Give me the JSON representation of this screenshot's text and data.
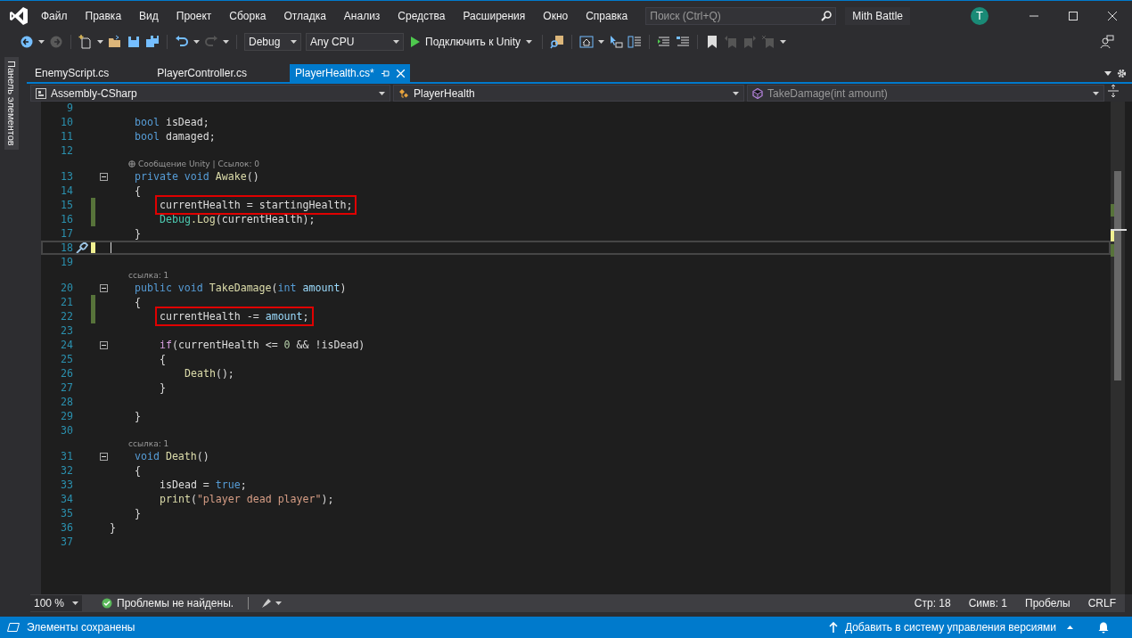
{
  "menu": [
    "Файл",
    "Правка",
    "Вид",
    "Проект",
    "Сборка",
    "Отладка",
    "Анализ",
    "Средства",
    "Расширения",
    "Окно",
    "Справка"
  ],
  "search": {
    "placeholder": "Поиск (Ctrl+Q)"
  },
  "solution_name": "Mith Battle",
  "account_initial": "T",
  "toolbar": {
    "configuration": "Debug",
    "platform": "Any CPU",
    "start_button": "Подключить к Unity"
  },
  "side_panel": {
    "label": "Панель элементов"
  },
  "tabs": [
    {
      "label": "EnemyScript.cs",
      "selected": false
    },
    {
      "label": "PlayerController.cs",
      "selected": false
    },
    {
      "label": "PlayerHealth.cs*",
      "selected": true
    }
  ],
  "navigation": {
    "project": "Assembly-CSharp",
    "type": "PlayerHealth",
    "member": "TakeDamage(int amount)"
  },
  "code_lines": [
    {
      "number": "9",
      "changed": false,
      "current": false,
      "boxed": false,
      "foldable": false
    },
    {
      "number": "10",
      "changed": false,
      "current": false,
      "boxed": false,
      "foldable": false,
      "tokens": [
        {
          "kind": "kw",
          "text": "    bool"
        },
        {
          "kind": "plain",
          "text": " isDead;"
        }
      ]
    },
    {
      "number": "11",
      "changed": false,
      "current": false,
      "boxed": false,
      "foldable": false,
      "tokens": [
        {
          "kind": "kw",
          "text": "    bool"
        },
        {
          "kind": "plain",
          "text": " damaged;"
        }
      ]
    },
    {
      "number": "12",
      "changed": false,
      "current": false,
      "boxed": false,
      "foldable": false
    },
    {
      "number": "13",
      "changed": false,
      "current": false,
      "boxed": false,
      "foldable": true,
      "codelens": {
        "kind": "unity",
        "text": "Сообщение Unity | Ссылок: 0"
      },
      "tokens": [
        {
          "kind": "kw",
          "text": "    private void"
        },
        {
          "kind": "method",
          "text": " Awake"
        },
        {
          "kind": "plain",
          "text": "()"
        }
      ]
    },
    {
      "number": "14",
      "changed": false,
      "current": false,
      "boxed": false,
      "foldable": false,
      "tokens": [
        {
          "kind": "plain",
          "text": "    {"
        }
      ]
    },
    {
      "number": "15",
      "changed": true,
      "saved": true,
      "current": false,
      "boxed": true,
      "foldable": false,
      "tokens": [
        {
          "kind": "plain",
          "text": "        currentHealth = startingHealth;"
        }
      ]
    },
    {
      "number": "16",
      "changed": true,
      "saved": true,
      "current": false,
      "boxed": false,
      "foldable": false,
      "tokens": [
        {
          "kind": "type",
          "text": "        Debug"
        },
        {
          "kind": "method",
          "text": ".Log"
        },
        {
          "kind": "plain",
          "text": "(currentHealth);"
        }
      ]
    },
    {
      "number": "17",
      "changed": false,
      "current": false,
      "boxed": false,
      "foldable": false,
      "tokens": [
        {
          "kind": "plain",
          "text": "    }"
        }
      ]
    },
    {
      "number": "18",
      "changed": true,
      "saved": false,
      "current": true,
      "boxed": false,
      "foldable": false
    },
    {
      "number": "19",
      "changed": false,
      "current": false,
      "boxed": false,
      "foldable": false
    },
    {
      "number": "20",
      "changed": false,
      "current": false,
      "boxed": false,
      "foldable": true,
      "codelens": {
        "kind": "references",
        "text": "ссылка: 1"
      },
      "tokens": [
        {
          "kind": "kw",
          "text": "    public void"
        },
        {
          "kind": "method",
          "text": " TakeDamage"
        },
        {
          "kind": "plain",
          "text": "("
        },
        {
          "kind": "kw",
          "text": "int"
        },
        {
          "kind": "param",
          "text": " amount"
        },
        {
          "kind": "plain",
          "text": ")"
        }
      ]
    },
    {
      "number": "21",
      "changed": true,
      "saved": true,
      "current": false,
      "boxed": false,
      "foldable": false,
      "tokens": [
        {
          "kind": "plain",
          "text": "    {"
        }
      ]
    },
    {
      "number": "22",
      "changed": true,
      "saved": true,
      "current": false,
      "boxed": true,
      "foldable": false,
      "tokens": [
        {
          "kind": "plain",
          "text": "        currentHealth -= "
        },
        {
          "kind": "param",
          "text": "amount"
        },
        {
          "kind": "plain",
          "text": ";"
        }
      ]
    },
    {
      "number": "23",
      "changed": false,
      "current": false,
      "boxed": false,
      "foldable": false
    },
    {
      "number": "24",
      "changed": false,
      "current": false,
      "boxed": false,
      "foldable": true,
      "tokens": [
        {
          "kind": "ctrl",
          "text": "        if"
        },
        {
          "kind": "plain",
          "text": "(currentHealth <= "
        },
        {
          "kind": "num",
          "text": "0"
        },
        {
          "kind": "plain",
          "text": " && !isDead)"
        }
      ]
    },
    {
      "number": "25",
      "changed": false,
      "current": false,
      "boxed": false,
      "foldable": false,
      "tokens": [
        {
          "kind": "plain",
          "text": "        {"
        }
      ]
    },
    {
      "number": "26",
      "changed": false,
      "current": false,
      "boxed": false,
      "foldable": false,
      "tokens": [
        {
          "kind": "method",
          "text": "            Death"
        },
        {
          "kind": "plain",
          "text": "();"
        }
      ]
    },
    {
      "number": "27",
      "changed": false,
      "current": false,
      "boxed": false,
      "foldable": false,
      "tokens": [
        {
          "kind": "plain",
          "text": "        }"
        }
      ]
    },
    {
      "number": "28",
      "changed": false,
      "current": false,
      "boxed": false,
      "foldable": false
    },
    {
      "number": "29",
      "changed": false,
      "current": false,
      "boxed": false,
      "foldable": false,
      "tokens": [
        {
          "kind": "plain",
          "text": "    }"
        }
      ]
    },
    {
      "number": "30",
      "changed": false,
      "current": false,
      "boxed": false,
      "foldable": false
    },
    {
      "number": "31",
      "changed": false,
      "current": false,
      "boxed": false,
      "foldable": true,
      "codelens": {
        "kind": "references",
        "text": "ссылка: 1"
      },
      "tokens": [
        {
          "kind": "kw",
          "text": "    void"
        },
        {
          "kind": "method",
          "text": " Death"
        },
        {
          "kind": "plain",
          "text": "()"
        }
      ]
    },
    {
      "number": "32",
      "changed": false,
      "current": false,
      "boxed": false,
      "foldable": false,
      "tokens": [
        {
          "kind": "plain",
          "text": "    {"
        }
      ]
    },
    {
      "number": "33",
      "changed": false,
      "current": false,
      "boxed": false,
      "foldable": false,
      "tokens": [
        {
          "kind": "plain",
          "text": "        isDead = "
        },
        {
          "kind": "kw",
          "text": "true"
        },
        {
          "kind": "plain",
          "text": ";"
        }
      ]
    },
    {
      "number": "34",
      "changed": false,
      "current": false,
      "boxed": false,
      "foldable": false,
      "tokens": [
        {
          "kind": "method",
          "text": "        print"
        },
        {
          "kind": "plain",
          "text": "("
        },
        {
          "kind": "str",
          "text": "\"player dead player\""
        },
        {
          "kind": "plain",
          "text": ");"
        }
      ]
    },
    {
      "number": "35",
      "changed": false,
      "current": false,
      "boxed": false,
      "foldable": false,
      "tokens": [
        {
          "kind": "plain",
          "text": "    }"
        }
      ]
    },
    {
      "number": "36",
      "changed": false,
      "current": false,
      "boxed": false,
      "foldable": false,
      "tokens": [
        {
          "kind": "plain",
          "text": "}"
        }
      ]
    },
    {
      "number": "37",
      "changed": false,
      "current": false,
      "boxed": false,
      "foldable": false
    }
  ],
  "editor_status": {
    "zoom": "100 %",
    "issues": "Проблемы не найдены.",
    "line": "Стр: 18",
    "column": "Симв: 1",
    "whitespace": "Пробелы",
    "line_endings": "CRLF"
  },
  "status_bar": {
    "message": "Элементы сохранены",
    "source_control": "Добавить в систему управления версиями"
  }
}
